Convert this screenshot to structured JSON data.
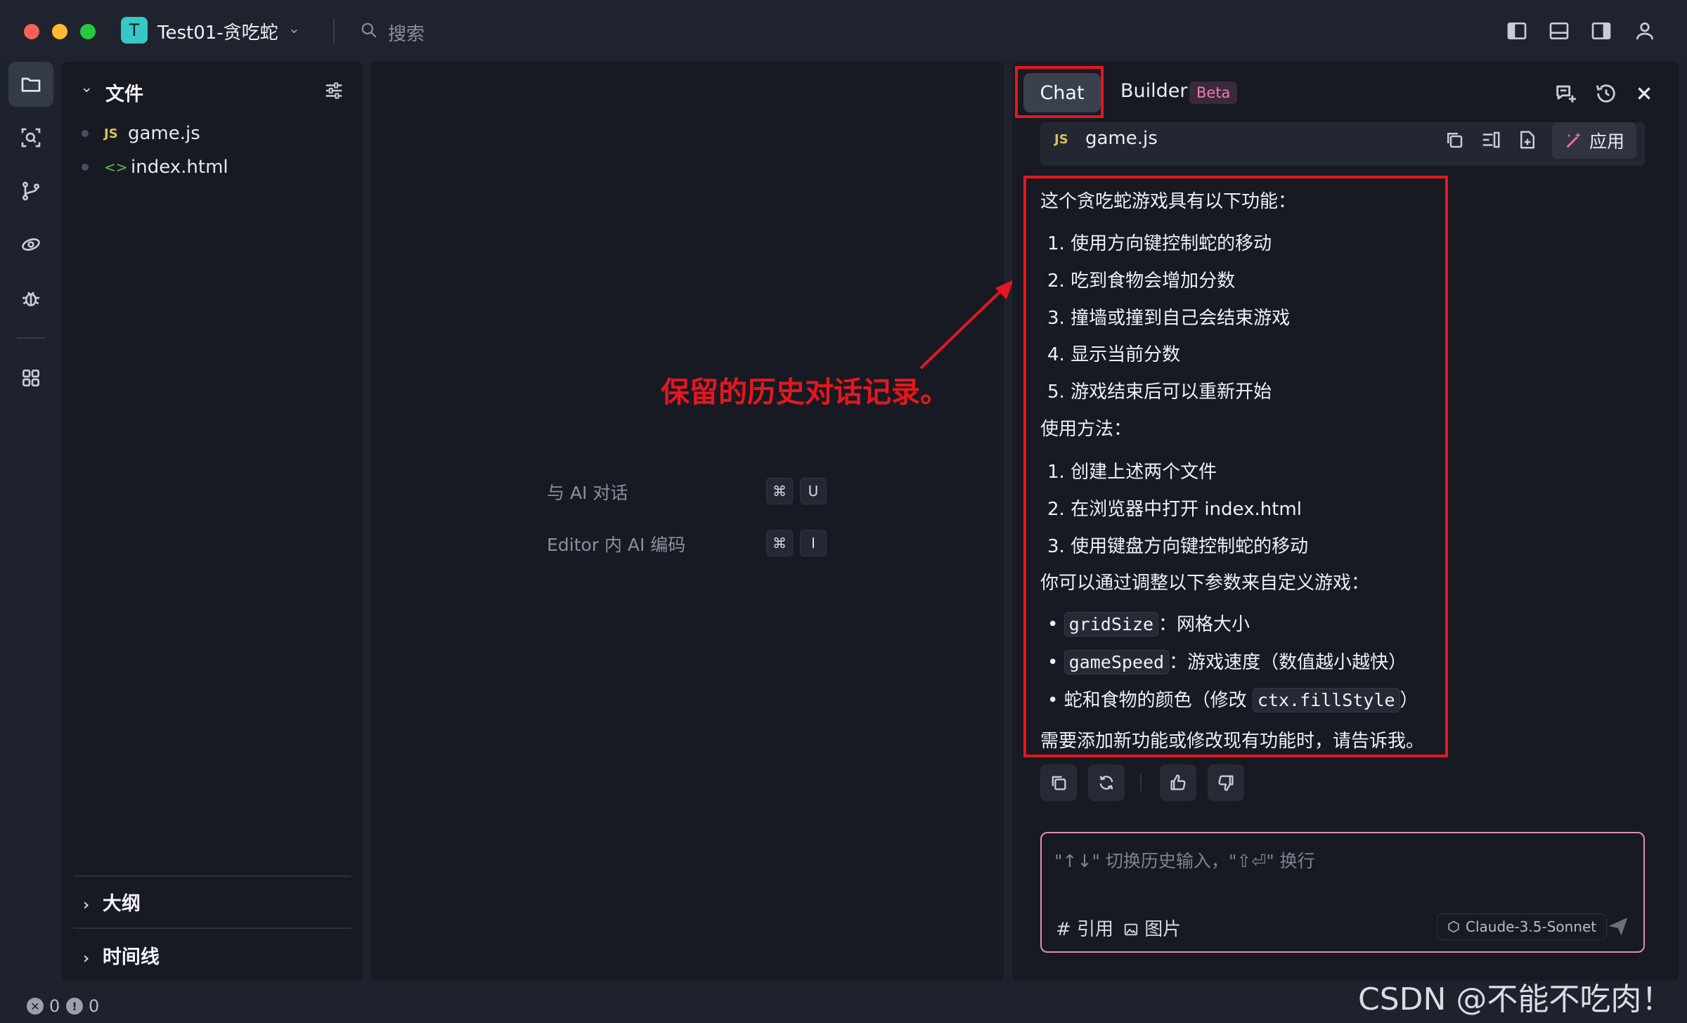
{
  "window": {
    "project_badge": "T",
    "project_name": "Test01-贪吃蛇",
    "search_placeholder": "搜索"
  },
  "activity_bar": {
    "items": [
      {
        "icon": "folder-icon",
        "active": true
      },
      {
        "icon": "search-code-icon",
        "active": false
      },
      {
        "icon": "git-branch-icon",
        "active": false
      },
      {
        "icon": "eye-orbit-icon",
        "active": false
      },
      {
        "icon": "bug-icon",
        "active": false
      },
      {
        "icon": "apps-grid-icon",
        "active": false
      }
    ]
  },
  "files_panel": {
    "title": "文件",
    "files": [
      {
        "icon": "JS",
        "name": "game.js"
      },
      {
        "icon": "<>",
        "name": "index.html"
      }
    ],
    "sections": [
      {
        "label": "大纲"
      },
      {
        "label": "时间线"
      }
    ]
  },
  "editor": {
    "hints": [
      {
        "label": "与 AI 对话",
        "keys": [
          "⌘",
          "U"
        ]
      },
      {
        "label": "Editor 内 AI 编码",
        "keys": [
          "⌘",
          "I"
        ]
      }
    ]
  },
  "chat": {
    "tabs": {
      "chat": "Chat",
      "builder": "Builder",
      "beta": "Beta"
    },
    "code_block": {
      "lang": "JS",
      "file": "game.js",
      "apply": "应用"
    },
    "message": {
      "intro": "这个贪吃蛇游戏具有以下功能：",
      "features": [
        "1. 使用方向键控制蛇的移动",
        "2. 吃到食物会增加分数",
        "3. 撞墙或撞到自己会结束游戏",
        "4. 显示当前分数",
        "5. 游戏结束后可以重新开始"
      ],
      "usage_title": "使用方法：",
      "usage": [
        "1. 创建上述两个文件",
        "2. 在浏览器中打开 index.html",
        "3. 使用键盘方向键控制蛇的移动"
      ],
      "custom_title": "你可以通过调整以下参数来自定义游戏：",
      "params": {
        "grid_code": "gridSize",
        "grid_desc": "：网格大小",
        "speed_code": "gameSpeed",
        "speed_desc": "：游戏速度（数值越小越快）",
        "color_pre": "蛇和食物的颜色（修改",
        "color_code": "ctx.fillStyle",
        "color_post": "）"
      },
      "closing": "需要添加新功能或修改现有功能时，请告诉我。"
    },
    "input": {
      "placeholder": "\"↑↓\" 切换历史输入，\"⇧⏎\" 换行",
      "cite": "# 引用",
      "image": "图片",
      "model": "Claude-3.5-Sonnet"
    }
  },
  "annotation": {
    "text": "保留的历史对话记录。",
    "color": "#e5161f"
  },
  "status_bar": {
    "errors": "0",
    "warnings": "0",
    "watermark": "CSDN @不能不吃肉！"
  }
}
